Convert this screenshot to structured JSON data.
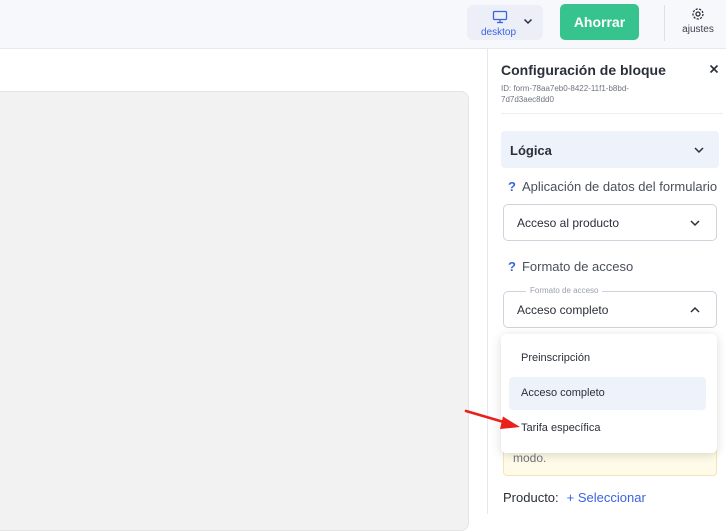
{
  "topbar": {
    "device_label": "desktop",
    "save_label": "Ahorrar",
    "settings_label": "ajustes"
  },
  "panel": {
    "title": "Configuración de bloque",
    "block_id": "ID: form-78aa7eb0-8422-11f1-b8bd-7d7d3aec8dd0",
    "logic_label": "Lógica",
    "help1_mark": "?",
    "help1_label": "Aplicación de datos del formulario",
    "select1_value": "Acceso al producto",
    "help2_mark": "?",
    "help2_label": "Formato de acceso",
    "select2_legend": "Formato de acceso",
    "select2_value": "Acceso completo",
    "hint_text": "modo.",
    "product_label": "Producto:",
    "product_select": "+ Seleccionar"
  },
  "dropdown": {
    "options": [
      {
        "label": "Preinscripción",
        "selected": false
      },
      {
        "label": "Acceso completo",
        "selected": true
      },
      {
        "label": "Tarifa específica",
        "selected": false
      }
    ]
  },
  "colors": {
    "accent": "#3a63e0",
    "save_button": "#37c38d",
    "annotation_arrow": "#e8211c"
  }
}
